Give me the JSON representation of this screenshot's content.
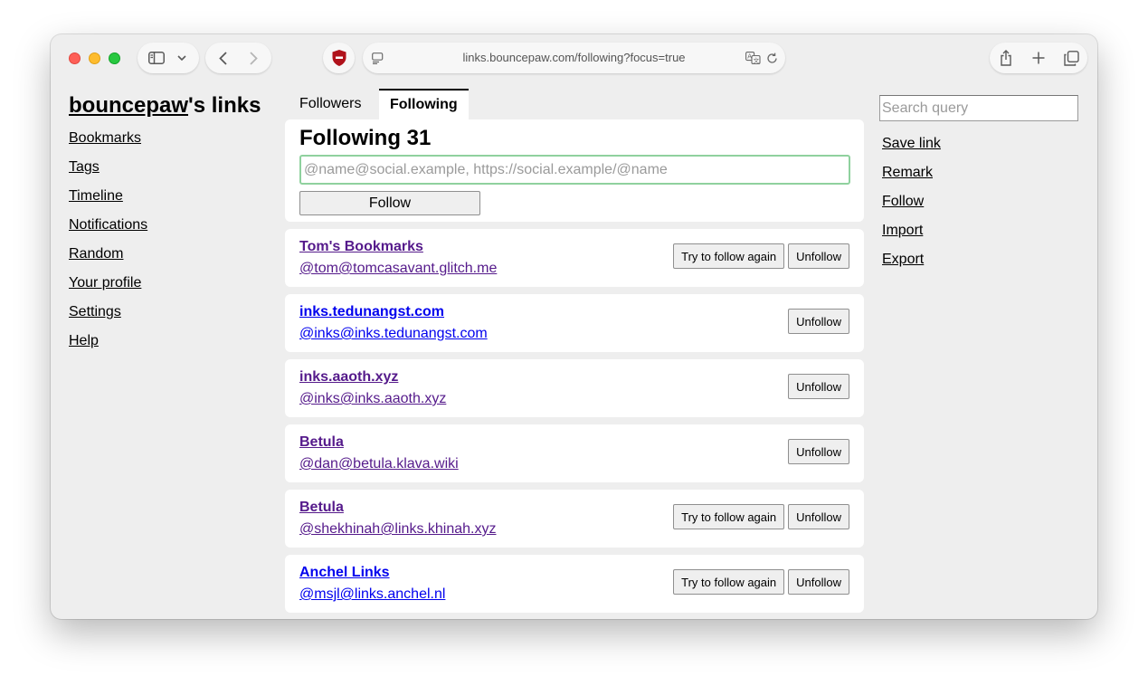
{
  "browser": {
    "url": "links.bouncepaw.com/following?focus=true",
    "icons": {
      "sidebar": "sidebar-icon",
      "chevron": "chevron-down-icon",
      "back": "back-arrow-icon",
      "forward": "forward-arrow-icon",
      "extension": "shield-blocker-icon",
      "page_menu": "page-menu-icon",
      "translate": "translate-icon",
      "reload": "reload-icon",
      "share": "share-icon",
      "new_tab": "plus-icon",
      "tabs": "tab-overview-icon"
    }
  },
  "site": {
    "owner": "bouncepaw",
    "title_suffix": "'s links"
  },
  "left_nav": [
    {
      "label": "Bookmarks"
    },
    {
      "label": "Tags"
    },
    {
      "label": "Timeline"
    },
    {
      "label": "Notifications"
    },
    {
      "label": "Random"
    },
    {
      "label": "Your profile"
    },
    {
      "label": "Settings"
    },
    {
      "label": "Help"
    }
  ],
  "tabs": {
    "followers": "Followers",
    "following": "Following",
    "active": "following"
  },
  "follow_form": {
    "heading": "Following 31",
    "input_value": "",
    "input_placeholder": "@name@social.example, https://social.example/@name",
    "button_label": "Follow"
  },
  "following": [
    {
      "name": "Tom's Bookmarks",
      "handle": "@tom@tomcasavant.glitch.me",
      "visited": true,
      "retry": true
    },
    {
      "name": "inks.tedunangst.com",
      "handle": "@inks@inks.tedunangst.com",
      "visited": false,
      "retry": false
    },
    {
      "name": "inks.aaoth.xyz",
      "handle": "@inks@inks.aaoth.xyz",
      "visited": true,
      "retry": false
    },
    {
      "name": "Betula",
      "handle": "@dan@betula.klava.wiki",
      "visited": true,
      "retry": false
    },
    {
      "name": "Betula",
      "handle": "@shekhinah@links.khinah.xyz",
      "visited": true,
      "retry": true
    },
    {
      "name": "Anchel Links",
      "handle": "@msjl@links.anchel.nl",
      "visited": false,
      "retry": true
    }
  ],
  "entry_buttons": {
    "retry_label": "Try to follow again",
    "unfollow_label": "Unfollow"
  },
  "search": {
    "value": "",
    "placeholder": "Search query"
  },
  "right_nav": [
    {
      "label": "Save link"
    },
    {
      "label": "Remark"
    },
    {
      "label": "Follow"
    },
    {
      "label": "Import"
    },
    {
      "label": "Export"
    }
  ],
  "colors": {
    "visited_link": "#551a8b",
    "unvisited_link": "#0000ee",
    "input_focus": "#8fd19e",
    "page_bg": "#eeeeee"
  }
}
